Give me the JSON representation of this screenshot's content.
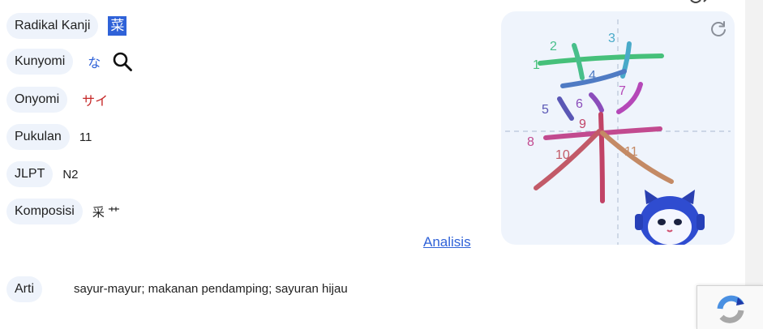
{
  "rows": {
    "radical": {
      "label": "Radikal Kanji",
      "value": "菜"
    },
    "kunyomi": {
      "label": "Kunyomi",
      "value": "な"
    },
    "onyomi": {
      "label": "Onyomi",
      "value": "サイ"
    },
    "strokes": {
      "label": "Pukulan",
      "value": "11"
    },
    "jlpt": {
      "label": "JLPT",
      "value": "N2"
    },
    "composition": {
      "label": "Komposisi",
      "value": "采 艹"
    }
  },
  "analysis_link": "Analisis",
  "meaning": {
    "label": "Arti",
    "value": "sayur-mayur; makanan pendamping; sayuran hijau"
  },
  "stroke_panel": {
    "kanji": "菜",
    "stroke_numbers": [
      "1",
      "2",
      "3",
      "4",
      "5",
      "6",
      "7",
      "8",
      "9",
      "10",
      "11"
    ]
  },
  "colors": {
    "accent": "#2f62d8",
    "onyomi": "#c62828",
    "pill_bg": "#eef3fb",
    "panel_bg": "#eff4fc"
  },
  "icons": {
    "search": "search-icon",
    "refresh": "refresh-icon",
    "recaptcha": "recaptcha-icon"
  }
}
